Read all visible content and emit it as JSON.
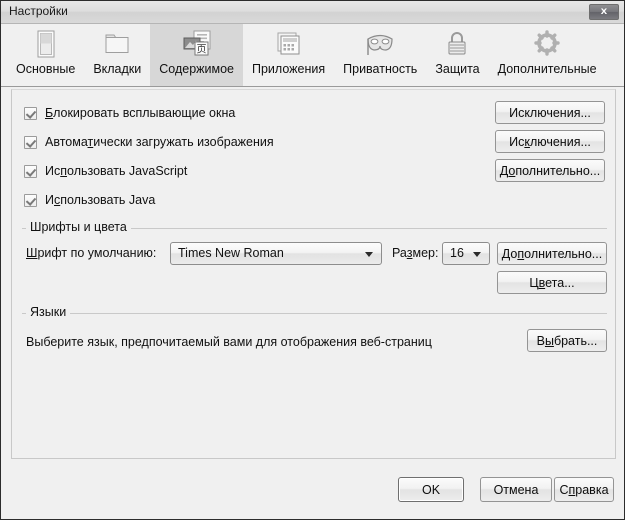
{
  "window": {
    "title": "Настройки",
    "close_label": "x"
  },
  "tabs": [
    {
      "label": "Основные",
      "icon": "browser-window-icon",
      "selected": false
    },
    {
      "label": "Вкладки",
      "icon": "folder-tabs-icon",
      "selected": false
    },
    {
      "label": "Содержимое",
      "icon": "content-page-icon",
      "selected": true
    },
    {
      "label": "Приложения",
      "icon": "applications-icon",
      "selected": false
    },
    {
      "label": "Приватность",
      "icon": "mask-icon",
      "selected": false
    },
    {
      "label": "Защита",
      "icon": "lock-icon",
      "selected": false
    },
    {
      "label": "Дополнительные",
      "icon": "gear-icon",
      "selected": false
    }
  ],
  "content": {
    "checkboxes": [
      {
        "pre": "",
        "acc": "Б",
        "post": "локировать всплывающие окна",
        "checked": true
      },
      {
        "pre": "Автома",
        "acc": "т",
        "post": "ически загружать изображения",
        "checked": true
      },
      {
        "pre": "Ис",
        "acc": "п",
        "post": "ользовать JavaScript",
        "checked": true
      },
      {
        "pre": "И",
        "acc": "с",
        "post": "пользовать Java",
        "checked": true
      }
    ],
    "side_buttons": [
      {
        "pre": "Исклю",
        "acc": "ю",
        "post": "чения...",
        "full": "Исключения...",
        "p1": "Исклю",
        "p2": "чения..."
      },
      {
        "pre": "Ис",
        "acc": "к",
        "post": "лючения...",
        "full": "Исключения..."
      },
      {
        "pre": "Д",
        "acc": "о",
        "post": "полнительно...",
        "full": "Дополнительно..."
      }
    ],
    "fonts_group": {
      "title": "Шрифты и цвета",
      "font_label_acc": "Ш",
      "font_label_rest": "рифт по умолчанию:",
      "font_value": "Times New Roman",
      "size_label_pre": "Ра",
      "size_label_acc": "з",
      "size_label_post": "мер:",
      "size_value": "16",
      "advanced_button": {
        "pre": "До",
        "acc": "п",
        "post": "олнительно..."
      },
      "colors_button": {
        "pre": "Ц",
        "acc": "в",
        "post": "ета..."
      }
    },
    "languages_group": {
      "title": "Языки",
      "description": "Выберите язык, предпочитаемый вами для отображения веб-страниц",
      "choose_button": {
        "pre": "В",
        "acc": "ы",
        "post": "брать..."
      }
    }
  },
  "footer": {
    "ok": "OK",
    "cancel": "Отмена",
    "help": {
      "pre": "С",
      "acc": "п",
      "post": "равка"
    }
  }
}
